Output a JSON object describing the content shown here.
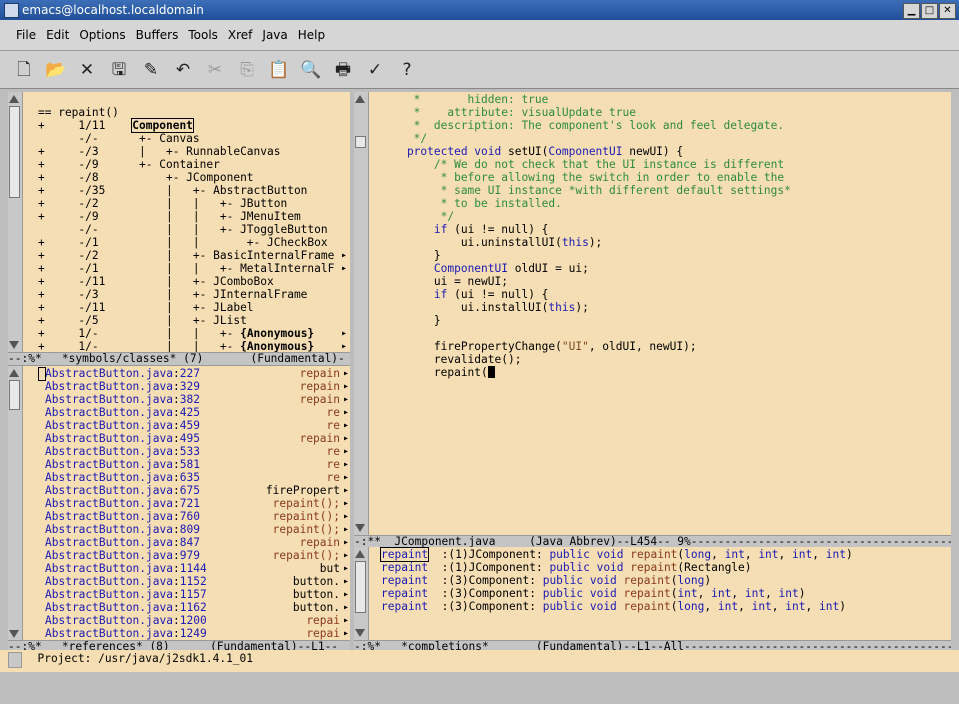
{
  "window": {
    "title": "emacs@localhost.localdomain",
    "min": "▁",
    "max": "□",
    "close": "✕"
  },
  "menubar": [
    "File",
    "Edit",
    "Options",
    "Buffers",
    "Tools",
    "Xref",
    "Java",
    "Help"
  ],
  "toolbar": [
    {
      "icon": "new-file-icon",
      "glyph": "🗋"
    },
    {
      "icon": "open-folder-icon",
      "glyph": "📂"
    },
    {
      "icon": "close-x-icon",
      "glyph": "✕"
    },
    {
      "icon": "save-disk-icon",
      "glyph": "🖫"
    },
    {
      "icon": "save-as-icon",
      "glyph": "✎"
    },
    {
      "icon": "undo-icon",
      "glyph": "↶"
    },
    {
      "icon": "cut-icon",
      "glyph": "✂",
      "dim": true
    },
    {
      "icon": "copy-icon",
      "glyph": "⎘",
      "dim": true
    },
    {
      "icon": "paste-icon",
      "glyph": "📋"
    },
    {
      "icon": "search-icon",
      "glyph": "🔍"
    },
    {
      "icon": "print-icon",
      "glyph": "🖶"
    },
    {
      "icon": "customize-icon",
      "glyph": "✓"
    },
    {
      "icon": "help-icon",
      "glyph": "?"
    }
  ],
  "symbols_pane": {
    "lines": [
      {
        "parts": [
          [
            "",
            "== repaint()"
          ]
        ]
      },
      {
        "parts": [
          [
            "",
            "+     1/11    "
          ],
          [
            "bold boxed",
            "Component"
          ]
        ]
      },
      {
        "parts": [
          [
            "",
            "      -/-      +- Canvas"
          ]
        ]
      },
      {
        "parts": [
          [
            "",
            "+     -/3      |   +- RunnableCanvas"
          ]
        ]
      },
      {
        "parts": [
          [
            "",
            "+     -/9      +- Container"
          ]
        ]
      },
      {
        "parts": [
          [
            "",
            "+     -/8          +- JComponent"
          ]
        ]
      },
      {
        "parts": [
          [
            "",
            "+     -/35         |   +- AbstractButton"
          ]
        ]
      },
      {
        "parts": [
          [
            "",
            "+     -/2          |   |   +- JButton"
          ]
        ]
      },
      {
        "parts": [
          [
            "",
            "+     -/9          |   |   +- JMenuItem"
          ]
        ]
      },
      {
        "parts": [
          [
            "",
            "      -/-          |   |   +- JToggleButton"
          ]
        ]
      },
      {
        "parts": [
          [
            "",
            "+     -/1          |   |       +- JCheckBox"
          ]
        ]
      },
      {
        "parts": [
          [
            "",
            "+     -/2          |   +- BasicInternalFrame"
          ]
        ]
      },
      {
        "parts": [
          [
            "",
            "+     -/1          |   |   +- MetalInternalF"
          ]
        ]
      },
      {
        "parts": [
          [
            "",
            "+     -/11         |   +- JComboBox"
          ]
        ]
      },
      {
        "parts": [
          [
            "",
            "+     -/3          |   +- JInternalFrame"
          ]
        ]
      },
      {
        "parts": [
          [
            "",
            "+     -/11         |   +- JLabel"
          ]
        ]
      },
      {
        "parts": [
          [
            "",
            "+     -/5          |   +- JList"
          ]
        ]
      },
      {
        "parts": [
          [
            "",
            "+     1/-          |   |   +- "
          ],
          [
            "bold",
            "{Anonymous}"
          ]
        ]
      },
      {
        "parts": [
          [
            "",
            "+     1/-          |   |   +- "
          ],
          [
            "bold",
            "{Anonymous}"
          ]
        ]
      }
    ],
    "modeline": "--:%*   *symbols/classes* (7)       (Fundamental)-"
  },
  "references_pane": {
    "rows": [
      {
        "file": "AbstractButton.java",
        "line": "227",
        "ctx": "repain"
      },
      {
        "file": "AbstractButton.java",
        "line": "329",
        "ctx": "repain"
      },
      {
        "file": "AbstractButton.java",
        "line": "382",
        "ctx": "repain"
      },
      {
        "file": "AbstractButton.java",
        "line": "425",
        "ctx": "re"
      },
      {
        "file": "AbstractButton.java",
        "line": "459",
        "ctx": "re"
      },
      {
        "file": "AbstractButton.java",
        "line": "495",
        "ctx": "repain"
      },
      {
        "file": "AbstractButton.java",
        "line": "533",
        "ctx": "re"
      },
      {
        "file": "AbstractButton.java",
        "line": "581",
        "ctx": "re"
      },
      {
        "file": "AbstractButton.java",
        "line": "635",
        "ctx": "re"
      },
      {
        "file": "AbstractButton.java",
        "line": "675",
        "ctx": "firePropert"
      },
      {
        "file": "AbstractButton.java",
        "line": "721",
        "ctx": "repaint();"
      },
      {
        "file": "AbstractButton.java",
        "line": "760",
        "ctx": "repaint();"
      },
      {
        "file": "AbstractButton.java",
        "line": "809",
        "ctx": "repaint();"
      },
      {
        "file": "AbstractButton.java",
        "line": "847",
        "ctx": "repain"
      },
      {
        "file": "AbstractButton.java",
        "line": "979",
        "ctx": "repaint();"
      },
      {
        "file": "AbstractButton.java",
        "line": "1144",
        "ctx": "but"
      },
      {
        "file": "AbstractButton.java",
        "line": "1152",
        "ctx": "button."
      },
      {
        "file": "AbstractButton.java",
        "line": "1157",
        "ctx": "button."
      },
      {
        "file": "AbstractButton.java",
        "line": "1162",
        "ctx": "button."
      },
      {
        "file": "AbstractButton.java",
        "line": "1200",
        "ctx": "repai"
      },
      {
        "file": "AbstractButton.java",
        "line": "1249",
        "ctx": "repai"
      }
    ],
    "modeline": "--:%*   *references* (8)      (Fundamental)--L1--"
  },
  "code_pane": {
    "lines": [
      [
        [
          "cm",
          "     *       hidden: true"
        ]
      ],
      [
        [
          "cm",
          "     *    attribute: visualUpdate true"
        ]
      ],
      [
        [
          "cm",
          "     *  description: The component's look and feel delegate."
        ]
      ],
      [
        [
          "cm",
          "     */"
        ]
      ],
      [
        [
          "kw",
          "    protected void "
        ],
        [
          "",
          "setUI("
        ],
        [
          "ty",
          "ComponentUI"
        ],
        [
          "",
          " newUI) {"
        ]
      ],
      [
        [
          "",
          "        "
        ],
        [
          "cm",
          "/* We do not check that the UI instance is different"
        ]
      ],
      [
        [
          "cm",
          "         * before allowing the switch in order to enable the"
        ]
      ],
      [
        [
          "cm",
          "         * same UI instance *with different default settings*"
        ]
      ],
      [
        [
          "cm",
          "         * to be installed."
        ]
      ],
      [
        [
          "cm",
          "         */"
        ]
      ],
      [
        [
          "",
          "        "
        ],
        [
          "kw",
          "if"
        ],
        [
          "",
          " (ui != null) {"
        ]
      ],
      [
        [
          "",
          "            ui.uninstallUI("
        ],
        [
          "kw",
          "this"
        ],
        [
          "",
          ");"
        ]
      ],
      [
        [
          "",
          "        }"
        ]
      ],
      [
        [
          "",
          "        "
        ],
        [
          "ty",
          "ComponentUI"
        ],
        [
          "",
          " oldUI = ui;"
        ]
      ],
      [
        [
          "",
          "        ui = newUI;"
        ]
      ],
      [
        [
          "",
          "        "
        ],
        [
          "kw",
          "if"
        ],
        [
          "",
          " (ui != null) {"
        ]
      ],
      [
        [
          "",
          "            ui.installUI("
        ],
        [
          "kw",
          "this"
        ],
        [
          "",
          ");"
        ]
      ],
      [
        [
          "",
          "        }"
        ]
      ],
      [
        [
          "",
          ""
        ]
      ],
      [
        [
          "",
          "        firePropertyChange("
        ],
        [
          "str",
          "\"UI\""
        ],
        [
          "",
          ", oldUI, newUI);"
        ]
      ],
      [
        [
          "",
          "        revalidate();"
        ]
      ],
      [
        [
          "",
          "        repaint("
        ],
        [
          "cursor",
          ""
        ]
      ]
    ],
    "modeline": "-:**  JComponent.java     (Java Abbrev)--L454-- 9%------------------------------------------------"
  },
  "completions_pane": {
    "rows": [
      {
        "name": "repaint",
        "num": "(1)",
        "cls": "JComponent:",
        "sig": [
          [
            "kw",
            "public void "
          ],
          [
            "ctx",
            "repaint"
          ],
          [
            "",
            "("
          ],
          [
            "kw",
            "long"
          ],
          [
            "",
            ", "
          ],
          [
            "kw",
            "int"
          ],
          [
            "",
            ", "
          ],
          [
            "kw",
            "int"
          ],
          [
            "",
            ", "
          ],
          [
            "kw",
            "int"
          ],
          [
            "",
            ", "
          ],
          [
            "kw",
            "int"
          ],
          [
            "",
            ")"
          ]
        ]
      },
      {
        "name": "repaint",
        "num": "(1)",
        "cls": "JComponent:",
        "sig": [
          [
            "kw",
            "public void "
          ],
          [
            "ctx",
            "repaint"
          ],
          [
            "",
            "(Rectangle)"
          ]
        ]
      },
      {
        "name": "repaint",
        "num": "(3)",
        "cls": "Component:",
        "sig": [
          [
            "kw",
            "public void "
          ],
          [
            "ctx",
            "repaint"
          ],
          [
            "",
            "("
          ],
          [
            "kw",
            "long"
          ],
          [
            "",
            ")"
          ]
        ]
      },
      {
        "name": "repaint",
        "num": "(3)",
        "cls": "Component:",
        "sig": [
          [
            "kw",
            "public void "
          ],
          [
            "ctx",
            "repaint"
          ],
          [
            "",
            "("
          ],
          [
            "kw",
            "int"
          ],
          [
            "",
            ", "
          ],
          [
            "kw",
            "int"
          ],
          [
            "",
            ", "
          ],
          [
            "kw",
            "int"
          ],
          [
            "",
            ", "
          ],
          [
            "kw",
            "int"
          ],
          [
            "",
            ")"
          ]
        ]
      },
      {
        "name": "repaint",
        "num": "(3)",
        "cls": "Component:",
        "sig": [
          [
            "kw",
            "public void "
          ],
          [
            "ctx",
            "repaint"
          ],
          [
            "",
            "("
          ],
          [
            "kw",
            "long"
          ],
          [
            "",
            ", "
          ],
          [
            "kw",
            "int"
          ],
          [
            "",
            ", "
          ],
          [
            "kw",
            "int"
          ],
          [
            "",
            ", "
          ],
          [
            "kw",
            "int"
          ],
          [
            "",
            ", "
          ],
          [
            "kw",
            "int"
          ],
          [
            "",
            ")"
          ]
        ]
      }
    ],
    "modeline": "-:%*   *completions*       (Fundamental)--L1--All---------------------------------------------"
  },
  "echo": "  Project: /usr/java/j2sdk1.4.1_01",
  "colors": {
    "pane_bg": "#f5deb3",
    "keyword": "#1a1ab4",
    "comment": "#2e8b3e",
    "title_bar": "#2c5aa0"
  }
}
